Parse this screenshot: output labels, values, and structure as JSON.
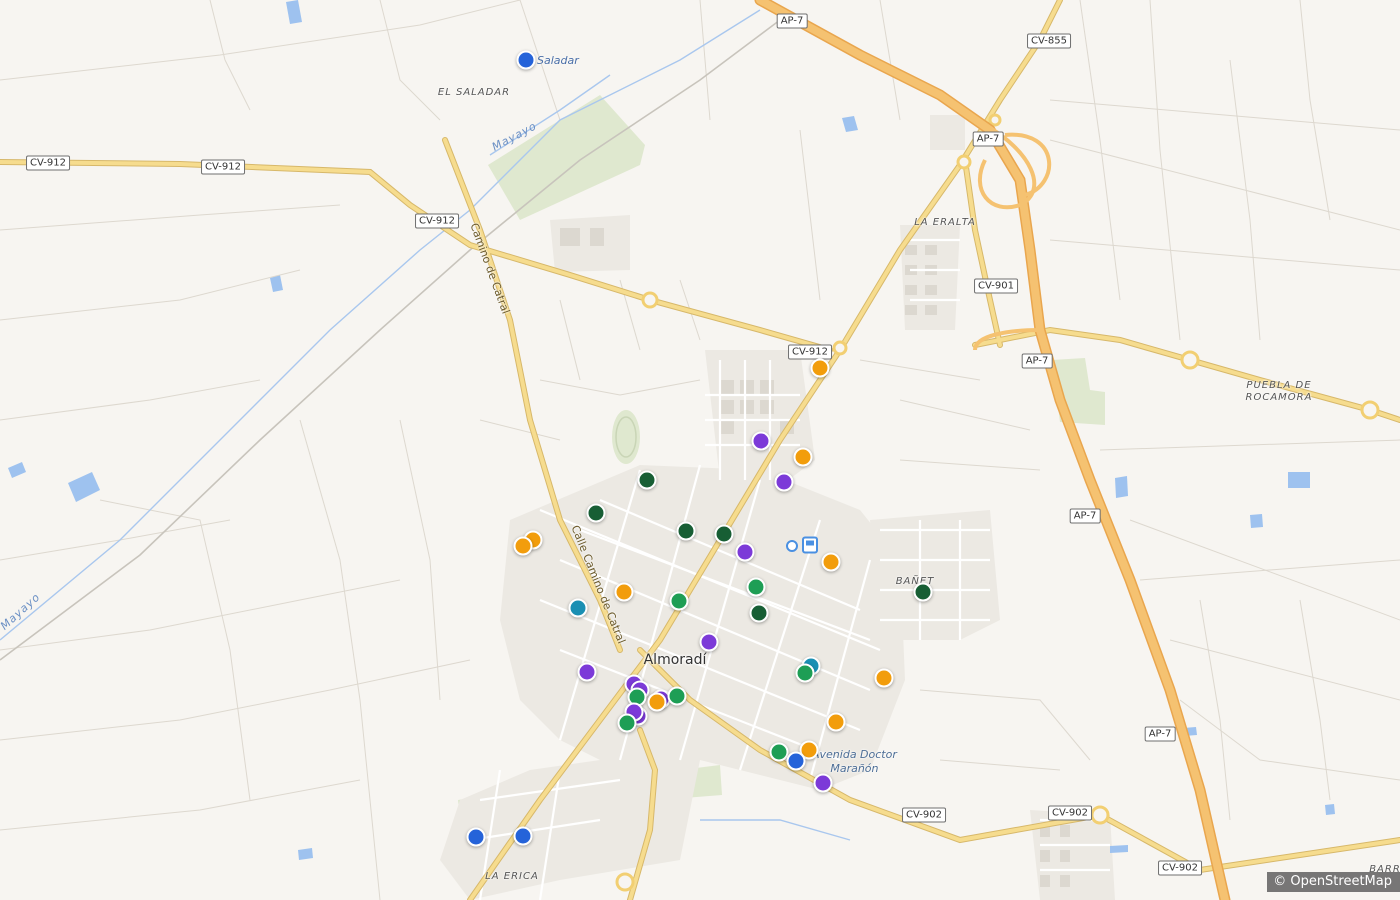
{
  "map": {
    "attribution": "© OpenStreetMap",
    "road_shields": [
      {
        "id": "ap7-top",
        "label": "AP-7"
      },
      {
        "id": "cv855",
        "label": "CV-855"
      },
      {
        "id": "ap7-junction",
        "label": "AP-7"
      },
      {
        "id": "cv912-west",
        "label": "CV-912"
      },
      {
        "id": "cv912-mid",
        "label": "CV-912"
      },
      {
        "id": "cv912-sw",
        "label": "CV-912"
      },
      {
        "id": "cv912-east",
        "label": "CV-912"
      },
      {
        "id": "cv901",
        "label": "CV-901"
      },
      {
        "id": "ap7-mid",
        "label": "AP-7"
      },
      {
        "id": "ap7-south",
        "label": "AP-7"
      },
      {
        "id": "ap7-low",
        "label": "AP-7"
      },
      {
        "id": "cv902-a",
        "label": "CV-902"
      },
      {
        "id": "cv902-b",
        "label": "CV-902"
      },
      {
        "id": "cv902-c",
        "label": "CV-902"
      }
    ],
    "places": {
      "el_saladar": "EL SALADAR",
      "la_eralta": "LA ERALTA",
      "puebla": "PUEBLA DE\nROCAMORA",
      "banet": "BAÑET",
      "la_erica": "LA ERICA",
      "barr": "BARR",
      "almoradi": "Almoradí"
    },
    "road_names": {
      "camino_catral": "Camino de Catral",
      "calle_camino_catral": "Calle Camino de Catral",
      "avenida": "Avenida Doctor\nMarañón"
    },
    "water_names": {
      "mayayo_n": "Mayayo",
      "mayayo_w": "Mayayo"
    },
    "poi": {
      "saladar": "Saladar"
    },
    "colors": {
      "blue": "#2563d9",
      "orange": "#f29d0c",
      "purple": "#7c3ad8",
      "green": "#1e9e55",
      "darkgreen": "#175e34",
      "teal": "#1a8fb3",
      "motorway": "#f3b960",
      "primary": "#f2d47a",
      "background": "#f7f5f1"
    },
    "markers": [
      {
        "id": "saladar",
        "color": "blue"
      },
      {
        "color": "orange"
      },
      {
        "color": "purple"
      },
      {
        "color": "orange"
      },
      {
        "color": "purple"
      },
      {
        "color": "darkgreen"
      },
      {
        "color": "darkgreen"
      },
      {
        "color": "orange"
      },
      {
        "color": "orange"
      },
      {
        "color": "darkgreen"
      },
      {
        "color": "darkgreen"
      },
      {
        "color": "purple"
      },
      {
        "color": "orange"
      },
      {
        "color": "darkgreen"
      },
      {
        "color": "green"
      },
      {
        "color": "orange"
      },
      {
        "color": "teal"
      },
      {
        "color": "green"
      },
      {
        "color": "darkgreen"
      },
      {
        "color": "purple"
      },
      {
        "color": "purple"
      },
      {
        "color": "teal"
      },
      {
        "color": "green"
      },
      {
        "color": "orange"
      },
      {
        "color": "purple"
      },
      {
        "color": "purple"
      },
      {
        "color": "green"
      },
      {
        "color": "purple"
      },
      {
        "color": "orange"
      },
      {
        "color": "green"
      },
      {
        "color": "purple"
      },
      {
        "color": "purple"
      },
      {
        "color": "green"
      },
      {
        "color": "orange"
      },
      {
        "color": "green"
      },
      {
        "color": "orange"
      },
      {
        "color": "blue"
      },
      {
        "color": "purple"
      },
      {
        "color": "blue"
      },
      {
        "color": "blue"
      }
    ]
  }
}
